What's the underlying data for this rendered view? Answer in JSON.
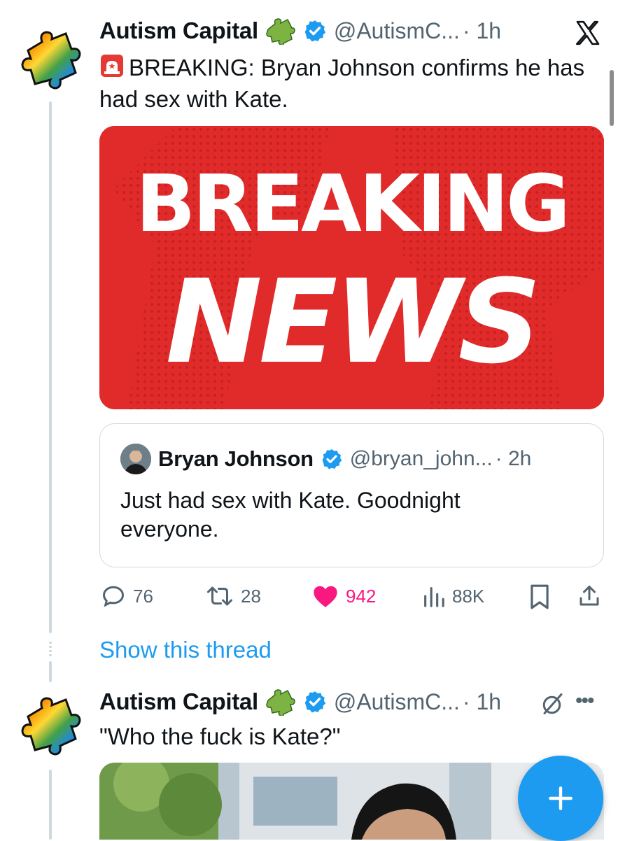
{
  "colors": {
    "accent": "#1d9bf0",
    "like": "#f91880",
    "text": "#0f1419",
    "muted": "#536471",
    "news_red": "#e12b2b"
  },
  "tweet1": {
    "author_name": "Autism Capital",
    "author_emoji": "puzzle-piece",
    "handle": "@AutismC...",
    "time": "· 1h",
    "alert_emoji": "police-light",
    "text": "BREAKING: Bryan Johnson confirms he has had sex with Kate.",
    "media": {
      "line1": "BREAKING",
      "line2": "NEWS"
    },
    "quote": {
      "author_name": "Bryan Johnson",
      "handle": "@bryan_john...",
      "time": "· 2h",
      "text": "Just had sex with Kate. Goodnight everyone."
    },
    "metrics": {
      "replies": "76",
      "reposts": "28",
      "likes": "942",
      "views": "88K"
    }
  },
  "show_thread": "Show this thread",
  "tweet2": {
    "author_name": "Autism Capital",
    "handle": "@AutismC...",
    "time": "· 1h",
    "text": "\"Who the fuck is Kate?\""
  },
  "icons": [
    "x-logo-icon",
    "verified-icon",
    "reply-icon",
    "repost-icon",
    "like-icon",
    "views-icon",
    "bookmark-icon",
    "share-icon",
    "grok-icon",
    "more-icon",
    "compose-icon"
  ]
}
